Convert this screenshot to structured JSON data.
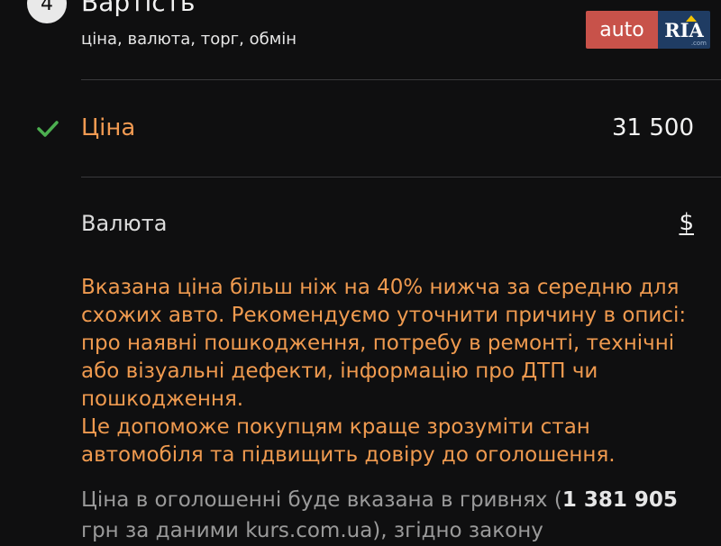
{
  "section": {
    "step_number": "4",
    "title": "Вартість",
    "subtitle": "ціна, валюта, торг, обмін"
  },
  "logo": {
    "auto": "auto",
    "ria": "RIA",
    "com": ".com"
  },
  "price": {
    "label": "Ціна",
    "value": "31 500",
    "icon": "check-icon"
  },
  "currency": {
    "label": "Валюта",
    "value": "$"
  },
  "warning": {
    "line1": "Вказана ціна більш ніж на 40% нижча за середню для схожих авто. Рекомендуємо уточнити причину в описі: про наявні пошкодження, потребу в ремонті, технічні або візуальні дефекти, інформацію про ДТП чи пошкодження.",
    "line2": "Це допоможе покупцям краще зрозуміти стан автомобіля та підвищить довіру до оголошення."
  },
  "info": {
    "text_before": "Ціна в оголошенні буде вказана в гривнях (",
    "amount": "1 381 905",
    "text_after": " грн за даними kurs.com.ua), згідно закону"
  },
  "colors": {
    "background": "#0f0f10",
    "accent_orange": "#ef9a4f",
    "check_green": "#4caf50",
    "logo_red": "#c8524a",
    "logo_blue": "#1f3c63"
  }
}
